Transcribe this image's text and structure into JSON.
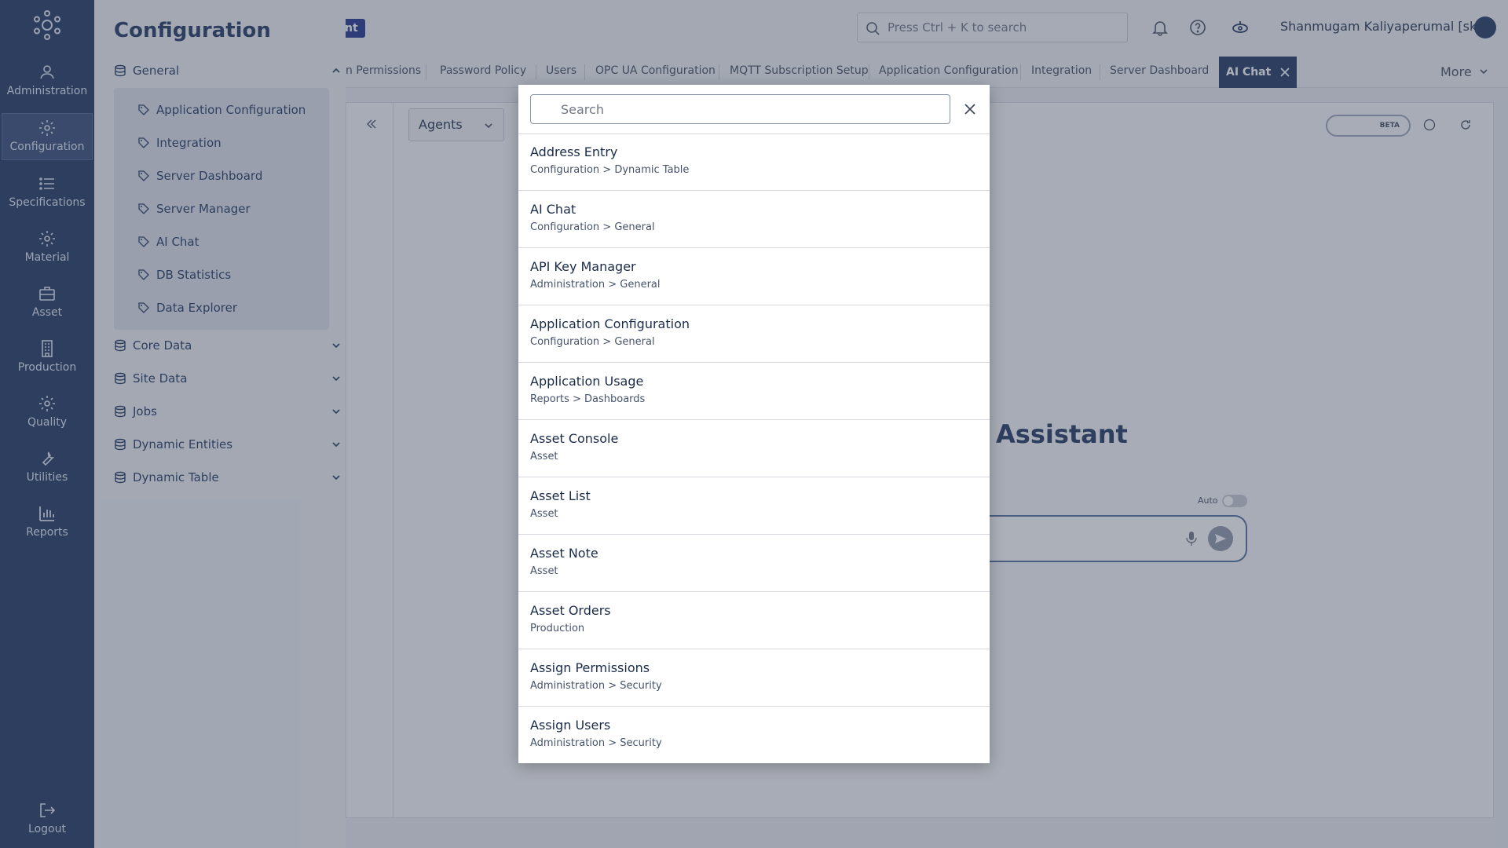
{
  "rail": {
    "items": [
      {
        "label": "Administration",
        "icon": "users-icon"
      },
      {
        "label": "Configuration",
        "icon": "gear-icon"
      },
      {
        "label": "Specifications",
        "icon": "list-icon"
      },
      {
        "label": "Material",
        "icon": "gear-icon"
      },
      {
        "label": "Asset",
        "icon": "briefcase-icon"
      },
      {
        "label": "Production",
        "icon": "building-icon"
      },
      {
        "label": "Quality",
        "icon": "gear-icon"
      },
      {
        "label": "Utilities",
        "icon": "wrench-icon"
      },
      {
        "label": "Reports",
        "icon": "bar-chart-icon"
      }
    ],
    "logout": "Logout"
  },
  "config": {
    "title": "Configuration",
    "groups": [
      {
        "label": "General",
        "expanded": true
      },
      {
        "label": "Core Data"
      },
      {
        "label": "Site Data"
      },
      {
        "label": "Jobs"
      },
      {
        "label": "Dynamic Entities"
      },
      {
        "label": "Dynamic Table"
      }
    ],
    "general_items": [
      "Application Configuration",
      "Integration",
      "Server Dashboard",
      "Server Manager",
      "AI Chat",
      "DB Statistics",
      "Data Explorer"
    ]
  },
  "header": {
    "badge": "nt",
    "search_placeholder": "Press Ctrl + K to search",
    "user": "Shanmugam Kaliyaperumal [sk]"
  },
  "tabs": {
    "items": [
      "n Permissions",
      "Password Policy",
      "Users",
      "OPC UA Configuration",
      "MQTT Subscription Setup",
      "Application Configuration",
      "Integration",
      "Server Dashboard"
    ],
    "active": "AI Chat",
    "more": "More"
  },
  "main": {
    "agents": "Agents",
    "beta": "BETA",
    "assistant_title": "Assistant",
    "auto_label": "Auto"
  },
  "modal": {
    "search_placeholder": "Search",
    "results": [
      {
        "title": "Address Entry",
        "path": "Configuration > Dynamic Table"
      },
      {
        "title": "AI Chat",
        "path": "Configuration > General"
      },
      {
        "title": "API Key Manager",
        "path": "Administration > General"
      },
      {
        "title": "Application Configuration",
        "path": "Configuration > General"
      },
      {
        "title": "Application Usage",
        "path": "Reports > Dashboards"
      },
      {
        "title": "Asset Console",
        "path": "Asset"
      },
      {
        "title": "Asset List",
        "path": "Asset"
      },
      {
        "title": "Asset Note",
        "path": "Asset"
      },
      {
        "title": "Asset Orders",
        "path": "Production"
      },
      {
        "title": "Assign Permissions",
        "path": "Administration > Security"
      },
      {
        "title": "Assign Users",
        "path": "Administration > Security"
      }
    ]
  },
  "colors": {
    "navy": "#18315c",
    "overlay": "rgba(70,80,100,0.45)"
  }
}
